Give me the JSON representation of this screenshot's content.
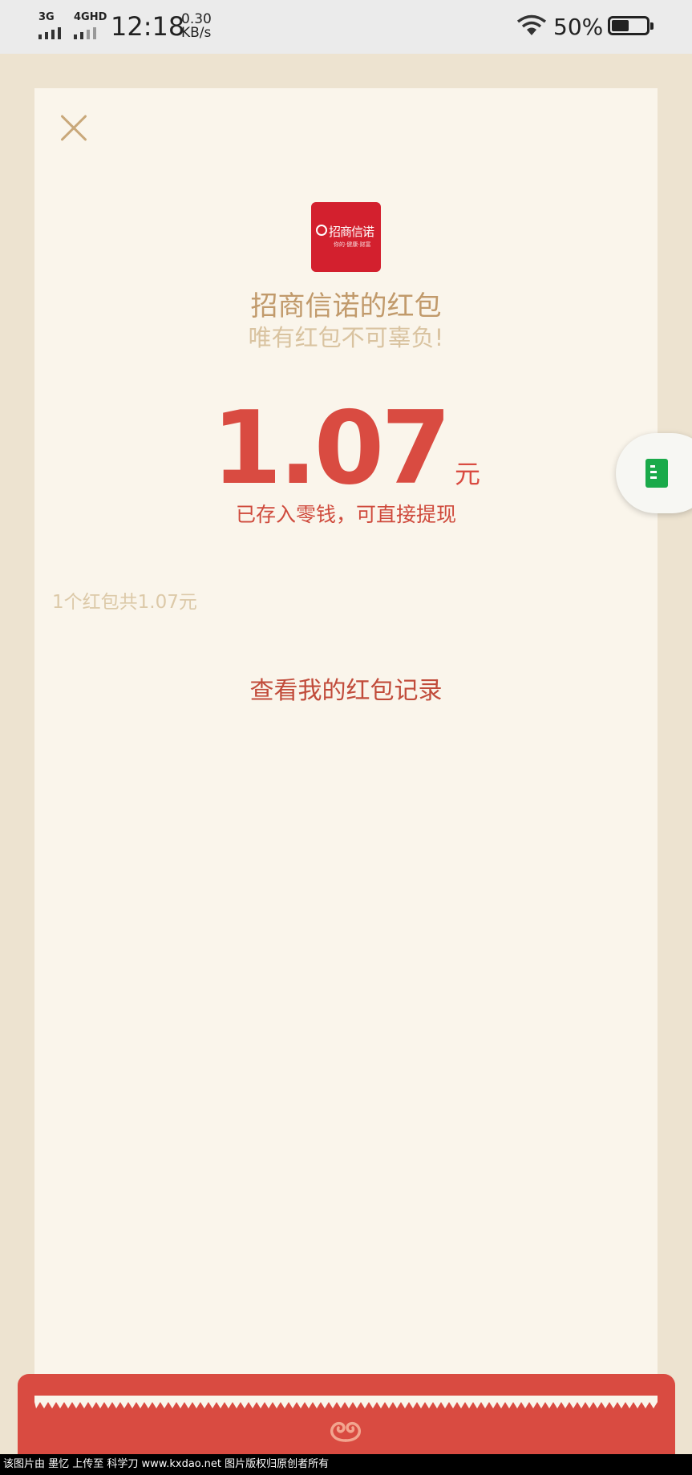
{
  "status_bar": {
    "sim1_label": "3G",
    "sim2_label": "4GHD",
    "time": "12:18",
    "speed_value": "0.30",
    "speed_unit": "KB/s",
    "battery_percent": "50%",
    "battery_level": 0.5
  },
  "card": {
    "sender_name": "招商信诺的红包",
    "wish": "唯有红包不可辜负!",
    "amount": "1.07",
    "unit": "元",
    "saved_note": "已存入零钱，可直接提现",
    "total_summary": "1个红包共1.07元",
    "record_link": "查看我的红包记录"
  },
  "logo": {
    "text": "招商信诺",
    "subtext": "你的·健康·财富"
  },
  "icons": {
    "close": "close-icon",
    "float": "note-doc-icon",
    "envelope": "swirl-icon"
  },
  "colors": {
    "accent_red": "#d94b41",
    "gold": "#c19a6b",
    "card_bg": "#faf5eb",
    "logo_red": "#d3202e"
  },
  "watermark": "该图片由 墨忆 上传至 科学刀 www.kxdao.net 图片版权归原创者所有"
}
